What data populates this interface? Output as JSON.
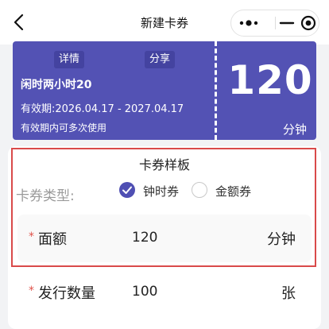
{
  "nav": {
    "title": "新建卡券",
    "icons": [
      "chevron-left-icon",
      "more-dots-icon",
      "minimize-icon",
      "target-close-icon"
    ]
  },
  "coupon": {
    "detail_btn": "详情",
    "share_btn": "分享",
    "name": "闲时两小时20",
    "validity": "有效期:2026.04.17 - 2027.04.17",
    "note": "有效期内可多次使用",
    "value": "120",
    "unit": "分钟",
    "color": "#5352b4"
  },
  "form": {
    "section_title": "卡券样板",
    "type_label": "卡券类型:",
    "type_options": [
      {
        "label": "钟时券",
        "selected": true
      },
      {
        "label": "金额券",
        "selected": false
      }
    ],
    "face_value": {
      "required_mark": "*",
      "label": "面额",
      "value": "120",
      "unit": "分钟"
    },
    "issue_qty": {
      "required_mark": "*",
      "label": "发行数量",
      "value": "100",
      "unit": "张"
    }
  },
  "colors": {
    "accent": "#4f4fb3",
    "highlight_border": "#d94a4a",
    "required": "#e0524a"
  }
}
